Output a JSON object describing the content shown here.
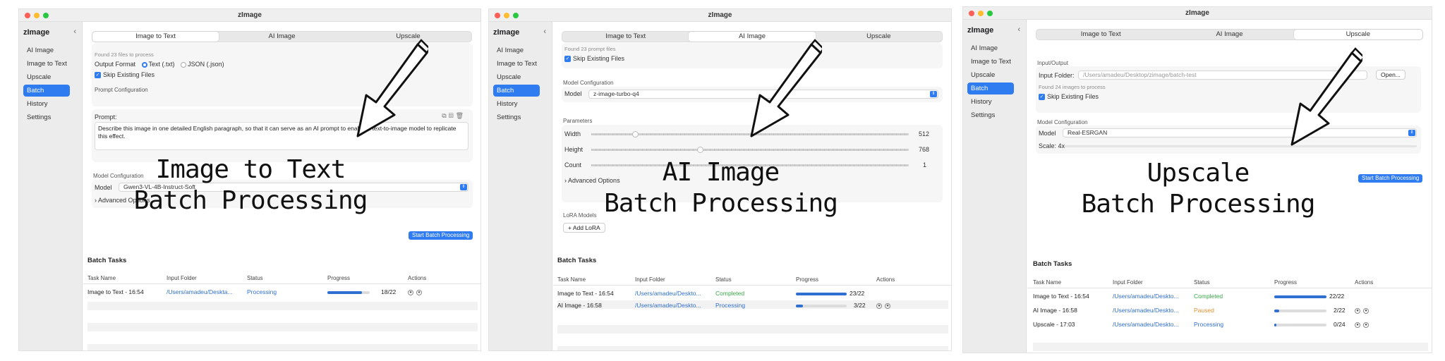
{
  "app_title": "zImage",
  "sidebar_items": [
    "AI Image",
    "Image to Text",
    "Upscale",
    "Batch",
    "History",
    "Settings"
  ],
  "tabs": [
    "Image to Text",
    "AI Image",
    "Upscale"
  ],
  "colors": {
    "accent": "#2f7bf0",
    "completed": "#3aa84a",
    "paused": "#e0902e",
    "link": "#2f6fcf"
  },
  "panel1": {
    "found_text": "Found 23 files to process",
    "output_format_label": "Output Format",
    "opt_txt": "Text (.txt)",
    "opt_json": "JSON (.json)",
    "skip_existing": "Skip Existing Files",
    "prompt_config": "Prompt Configuration",
    "prompt_label": "Prompt:",
    "prompt_text": "Describe this image in one detailed English paragraph, so that it can serve as an AI prompt to enable a text-to-image model to replicate this effect.",
    "model_config": "Model Configuration",
    "model_label": "Model",
    "model_value": "Gwen3-VL-4B-Instruct-Soft",
    "advanced": "Advanced Options",
    "start_button": "Start Batch Processing",
    "overlay_line1": "Image to Text",
    "overlay_line2": "Batch Processing",
    "tasks_title": "Batch Tasks",
    "headers": [
      "Task Name",
      "Input Folder",
      "Status",
      "Progress",
      "Actions"
    ],
    "rows": [
      {
        "name": "Image to Text - 16:54",
        "folder": "/Users/amadeu/Deskta...",
        "status": "Processing",
        "progress": "18/22",
        "fraction": 0.82
      }
    ]
  },
  "panel2": {
    "found_text": "Found 23 prompt files",
    "skip_existing": "Skip Existing Files",
    "model_config": "Model Configuration",
    "model_label": "Model",
    "model_value": "z-image-turbo-q4",
    "parameters": "Parameters",
    "width_label": "Width",
    "width_value": "512",
    "height_label": "Height",
    "height_value": "768",
    "count_label": "Count",
    "count_value": "1",
    "advanced": "Advanced Options",
    "lora_models": "LoRA Models",
    "add_lora": "Add LoRA",
    "overlay_line1": "AI Image",
    "overlay_line2": "Batch Processing",
    "tasks_title": "Batch Tasks",
    "headers": [
      "Task Name",
      "Input Folder",
      "Status",
      "Progress",
      "Actions"
    ],
    "rows": [
      {
        "name": "Image to Text - 16:54",
        "folder": "/Users/amadeu/Deskto...",
        "status": "Completed",
        "progress": "23/22",
        "fraction": 1.0
      },
      {
        "name": "AI Image - 16:58",
        "folder": "/Users/amadeu/Deskto...",
        "status": "Processing",
        "progress": "3/22",
        "fraction": 0.14
      }
    ]
  },
  "panel3": {
    "io_label": "Input/Output",
    "input_folder_label": "Input Folder:",
    "input_folder_value": "/Users/amadeu/Desktop/zimage/batch-test",
    "open_button": "Open...",
    "found_text": "Found 24 images to process",
    "skip_existing": "Skip Existing Files",
    "model_config": "Model Configuration",
    "model_label": "Model",
    "model_value": "Real-ESRGAN",
    "scale_label": "Scale: 4x",
    "start_button": "Start Batch Processing",
    "overlay_line1": "Upscale",
    "overlay_line2": "Batch Processing",
    "tasks_title": "Batch Tasks",
    "headers": [
      "Task Name",
      "Input Folder",
      "Status",
      "Progress",
      "Actions"
    ],
    "rows": [
      {
        "name": "Image to Text - 16:54",
        "folder": "/Users/amadeu/Deskto...",
        "status": "Completed",
        "progress": "22/22",
        "fraction": 1.0
      },
      {
        "name": "AI Image - 16:58",
        "folder": "/Users/amadeu/Deskto...",
        "status": "Paused",
        "progress": "2/22",
        "fraction": 0.1
      },
      {
        "name": "Upscale - 17:03",
        "folder": "/Users/amadeu/Deskto...",
        "status": "Processing",
        "progress": "0/24",
        "fraction": 0.04
      }
    ]
  }
}
